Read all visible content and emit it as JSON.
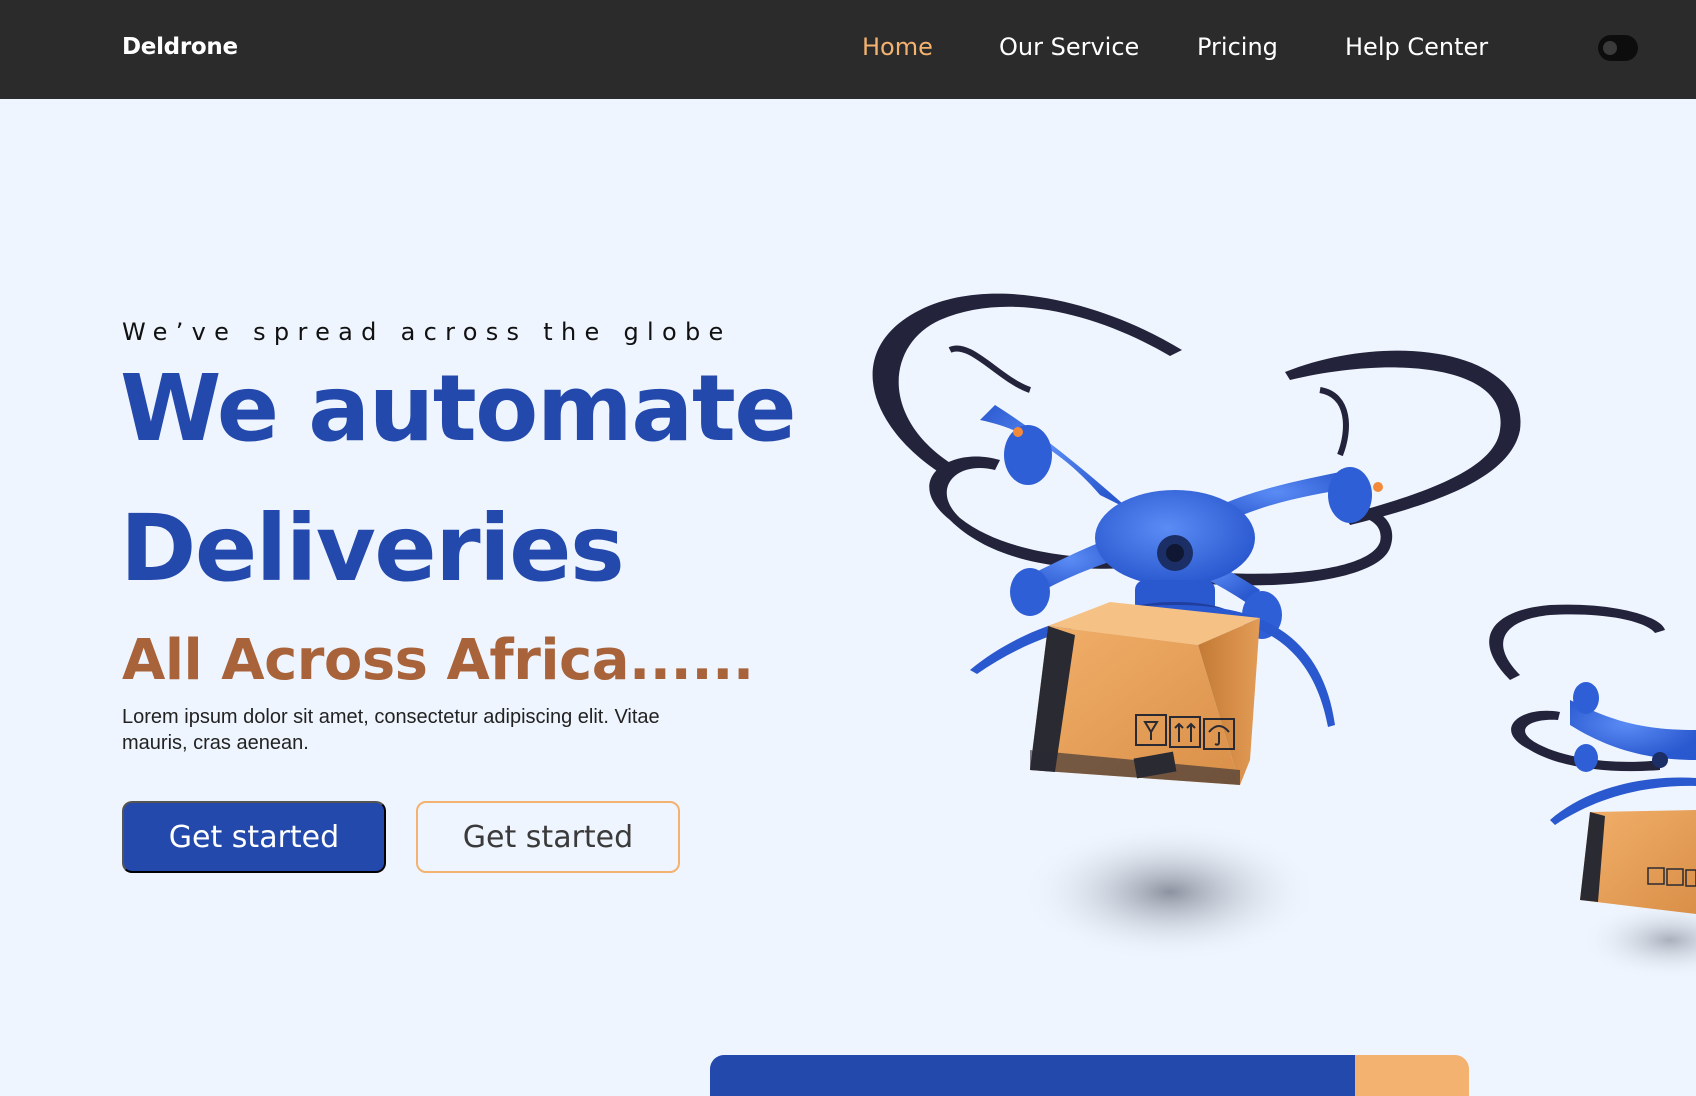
{
  "nav": {
    "brand": "Deldrone",
    "links": [
      {
        "label": "Home",
        "active": true
      },
      {
        "label": "Our Service",
        "active": false
      },
      {
        "label": "Pricing",
        "active": false
      },
      {
        "label": "Help Center",
        "active": false
      }
    ],
    "theme_toggle_icon": "toggle-icon"
  },
  "hero": {
    "eyebrow": "We’ve spread across the globe",
    "headline_line1": "We automate",
    "headline_line2": "Deliveries",
    "subhead": "All Across Africa......",
    "body": "Lorem ipsum dolor sit amet, consectetur adipiscing elit. Vitae mauris, cras aenean.",
    "primary_button": "Get started",
    "secondary_button": "Get started"
  },
  "colors": {
    "background": "#eff5fe",
    "navbar": "#2b2b2b",
    "primary_blue": "#2449ad",
    "accent_orange": "#f3b26f",
    "subhead_brown": "#a9633a"
  },
  "illustration": {
    "main": "delivery-drone-with-box",
    "secondary": "delivery-drone-with-box"
  }
}
